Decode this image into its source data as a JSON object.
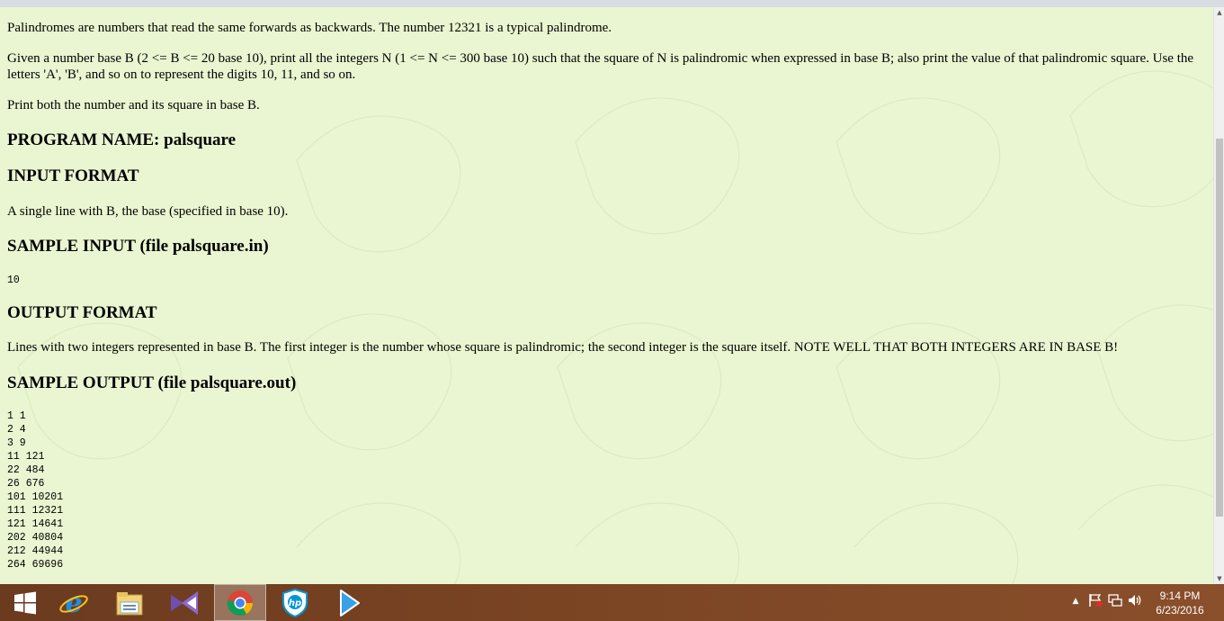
{
  "problem": {
    "intro": "Palindromes are numbers that read the same forwards as backwards. The number 12321 is a typical palindrome.",
    "task": "Given a number base B (2 <= B <= 20 base 10), print all the integers N (1 <= N <= 300 base 10) such that the square of N is palindromic when expressed in base B; also print the value of that palindromic square. Use the letters 'A', 'B', and so on to represent the digits 10, 11, and so on.",
    "print_note": "Print both the number and its square in base B.",
    "program_name_heading": "PROGRAM NAME: palsquare",
    "input_format_heading": "INPUT FORMAT",
    "input_format_text": "A single line with B, the base (specified in base 10).",
    "sample_input_heading": "SAMPLE INPUT (file palsquare.in)",
    "sample_input": "10",
    "output_format_heading": "OUTPUT FORMAT",
    "output_format_text": "Lines with two integers represented in base B. The first integer is the number whose square is palindromic; the second integer is the square itself. NOTE WELL THAT BOTH INTEGERS ARE IN BASE B!",
    "sample_output_heading": "SAMPLE OUTPUT (file palsquare.out)",
    "sample_output_lines": [
      "1 1",
      "2 4",
      "3 9",
      "11 121",
      "22 484",
      "26 676",
      "101 10201",
      "111 12321",
      "121 14641",
      "202 40804",
      "212 44944",
      "264 69696"
    ]
  },
  "taskbar": {
    "apps": [
      {
        "name": "start-button",
        "icon": "windows-logo-icon"
      },
      {
        "name": "internet-explorer",
        "icon": "internet-explorer-icon"
      },
      {
        "name": "file-explorer",
        "icon": "folder-icon"
      },
      {
        "name": "visual-studio",
        "icon": "visual-studio-icon"
      },
      {
        "name": "chrome",
        "icon": "chrome-icon",
        "active": true
      },
      {
        "name": "hp-support",
        "icon": "hp-shield-icon"
      },
      {
        "name": "media-player",
        "icon": "play-arrow-icon"
      }
    ],
    "tray": {
      "show_hidden": "▲",
      "time": "9:14 PM",
      "date": "6/23/2016"
    }
  },
  "colors": {
    "page_background": "#e9f6d1",
    "taskbar": "#7a4423"
  }
}
